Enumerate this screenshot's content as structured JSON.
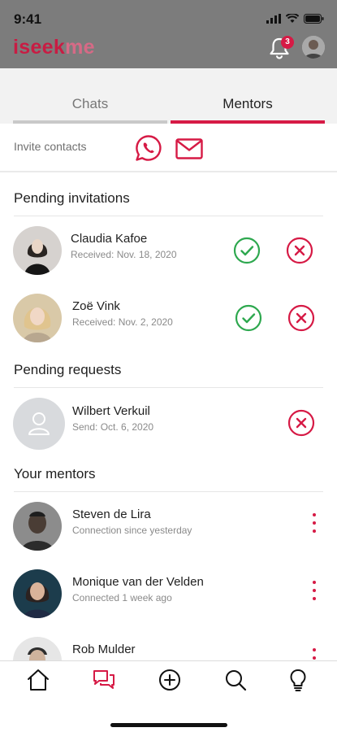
{
  "status": {
    "time": "9:41"
  },
  "app": {
    "logo_part1": "iseek",
    "logo_part2": "me",
    "notification_count": "3",
    "colors": {
      "brand": "#d61a45",
      "header": "#7c7c7c",
      "accept": "#2ea84f"
    }
  },
  "tabs": [
    {
      "label": "Chats",
      "active": false
    },
    {
      "label": "Mentors",
      "active": true
    }
  ],
  "invite": {
    "label": "Invite contacts",
    "icons": [
      "whatsapp-icon",
      "mail-icon"
    ]
  },
  "pending_invitations": {
    "title": "Pending invitations",
    "items": [
      {
        "name": "Claudia Kafoe",
        "detail": "Received: Nov. 18, 2020"
      },
      {
        "name": "Zoë Vink",
        "detail": "Received: Nov. 2, 2020"
      }
    ]
  },
  "pending_requests": {
    "title": "Pending requests",
    "items": [
      {
        "name": "Wilbert Verkuil",
        "detail": "Send: Oct. 6, 2020"
      }
    ]
  },
  "your_mentors": {
    "title": "Your mentors",
    "items": [
      {
        "name": "Steven de Lira",
        "detail": "Connection since yesterday"
      },
      {
        "name": "Monique van der Velden",
        "detail": "Connected 1 week ago"
      },
      {
        "name": "Rob Mulder",
        "detail": ""
      }
    ]
  },
  "bottom_nav": [
    "home-icon",
    "chats-icon",
    "add-icon",
    "search-icon",
    "lightbulb-icon"
  ]
}
